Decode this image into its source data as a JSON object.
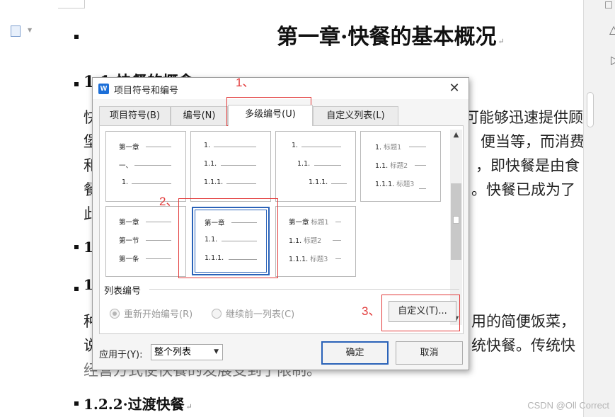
{
  "document": {
    "chapter_title": "第一章·快餐的基本概况",
    "heading_1_1": "1.1 快餐的概念",
    "para1_lines": [
      "快",
      "堡",
      "和",
      "餐",
      "此"
    ],
    "para1_right": [
      "可能够迅速提供顾",
      "便当等，而消费",
      "，即快餐是由食",
      "。快餐已成为了"
    ],
    "heading_1_2": "1",
    "heading_1_2_1": "1",
    "para2_left": [
      "种",
      "说",
      "经营方式使快餐的发展受到了限制。"
    ],
    "para2_right": [
      "用的简便饭菜，",
      "统快餐。传统快"
    ],
    "heading_1_2_2": "1.2.2·过渡快餐",
    "para_mark": "↵"
  },
  "dialog": {
    "title": "项目符号和编号",
    "close_glyph": "✕",
    "tabs": [
      {
        "label": "项目符号(B)"
      },
      {
        "label": "编号(N)"
      },
      {
        "label": "多级编号(U)"
      },
      {
        "label": "自定义列表(L)"
      }
    ],
    "active_tab": "多级编号(U)",
    "thumbnails": [
      {
        "rows": [
          "第一章",
          "一、",
          "1."
        ]
      },
      {
        "rows": [
          "1.",
          "1.1.",
          "1.1.1."
        ]
      },
      {
        "rows": [
          "1.",
          "1.1.",
          "1.1.1."
        ]
      },
      {
        "rows": [
          "1.",
          "1.1.",
          "1.1.1."
        ],
        "titles": [
          "标题1",
          "标题2",
          "标题3"
        ]
      },
      {
        "rows": [
          "第一章",
          "第一节",
          "第一条"
        ]
      },
      {
        "rows": [
          "第一章",
          "1.1.",
          "1.1.1."
        ]
      },
      {
        "rows": [
          "第一章",
          "1.1.",
          "1.1.1."
        ],
        "titles": [
          "标题1",
          "标题2",
          "标题3"
        ]
      }
    ],
    "selected_thumbnail": 6,
    "list_group_label": "列表编号",
    "radio_restart": "重新开始编号(R)",
    "radio_continue": "继续前一列表(C)",
    "customize_button": "自定义(T)...",
    "apply_to_label": "应用于(Y):",
    "apply_to_value": "整个列表",
    "ok_button": "确定",
    "cancel_button": "取消"
  },
  "annotations": {
    "step1": "1、",
    "step2": "2、",
    "step3": "3、"
  },
  "watermark": "CSDN @Oll Correct",
  "colors": {
    "annotation_red": "#e23a3a",
    "selection_blue": "#2a62b8",
    "app_icon_blue": "#1c6fd8"
  }
}
